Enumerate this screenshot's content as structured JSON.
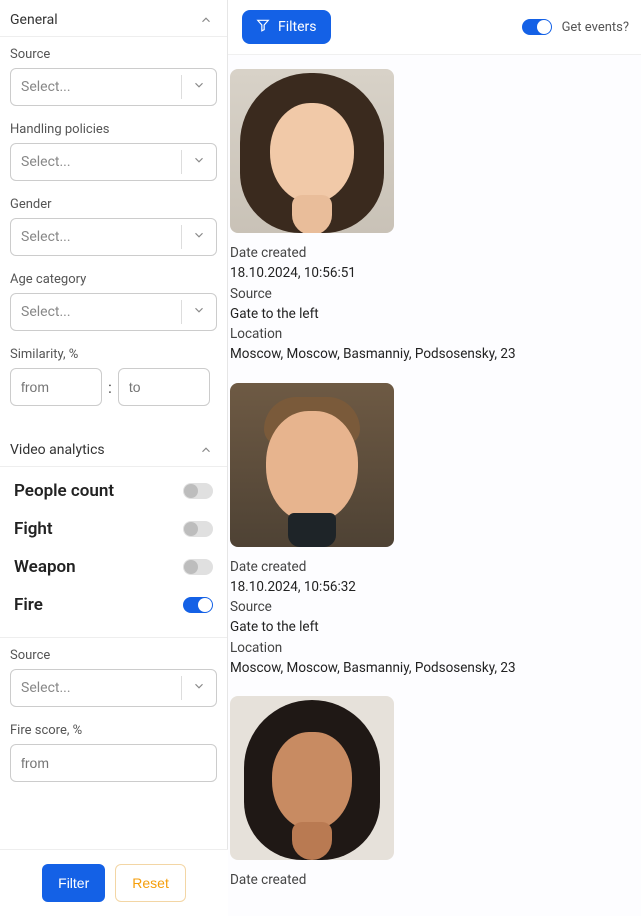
{
  "sidebar": {
    "sections": {
      "general": {
        "title": "General",
        "fields": {
          "source": {
            "label": "Source",
            "placeholder": "Select..."
          },
          "handling_policies": {
            "label": "Handling policies",
            "placeholder": "Select..."
          },
          "gender": {
            "label": "Gender",
            "placeholder": "Select..."
          },
          "age": {
            "label": "Age category",
            "placeholder": "Select..."
          },
          "similarity": {
            "label": "Similarity, %",
            "from": "from",
            "to": "to",
            "sep": ":"
          }
        }
      },
      "video_analytics": {
        "title": "Video analytics",
        "toggles": {
          "people_count": {
            "label": "People count",
            "on": false
          },
          "fight": {
            "label": "Fight",
            "on": false
          },
          "weapon": {
            "label": "Weapon",
            "on": false
          },
          "fire": {
            "label": "Fire",
            "on": true
          }
        },
        "fields": {
          "source": {
            "label": "Source",
            "placeholder": "Select..."
          },
          "fire_score": {
            "label": "Fire score, %",
            "from": "from"
          }
        }
      }
    },
    "buttons": {
      "filter": "Filter",
      "reset": "Reset"
    }
  },
  "topbar": {
    "filters_label": "Filters",
    "get_events_label": "Get events?",
    "get_events_on": true
  },
  "events": [
    {
      "date_label": "Date created",
      "date_value": "18.10.2024, 10:56:51",
      "source_label": "Source",
      "source_value": "Gate to the left",
      "location_label": "Location",
      "location_value": "Moscow, Moscow, Basmanniy, Podsosensky, 23",
      "face_variant": "f1"
    },
    {
      "date_label": "Date created",
      "date_value": "18.10.2024, 10:56:32",
      "source_label": "Source",
      "source_value": "Gate to the left",
      "location_label": "Location",
      "location_value": "Moscow, Moscow, Basmanniy, Podsosensky, 23",
      "face_variant": "f2"
    },
    {
      "date_label": "Date created",
      "date_value": "",
      "source_label": "",
      "source_value": "",
      "location_label": "",
      "location_value": "",
      "face_variant": "f3"
    }
  ]
}
